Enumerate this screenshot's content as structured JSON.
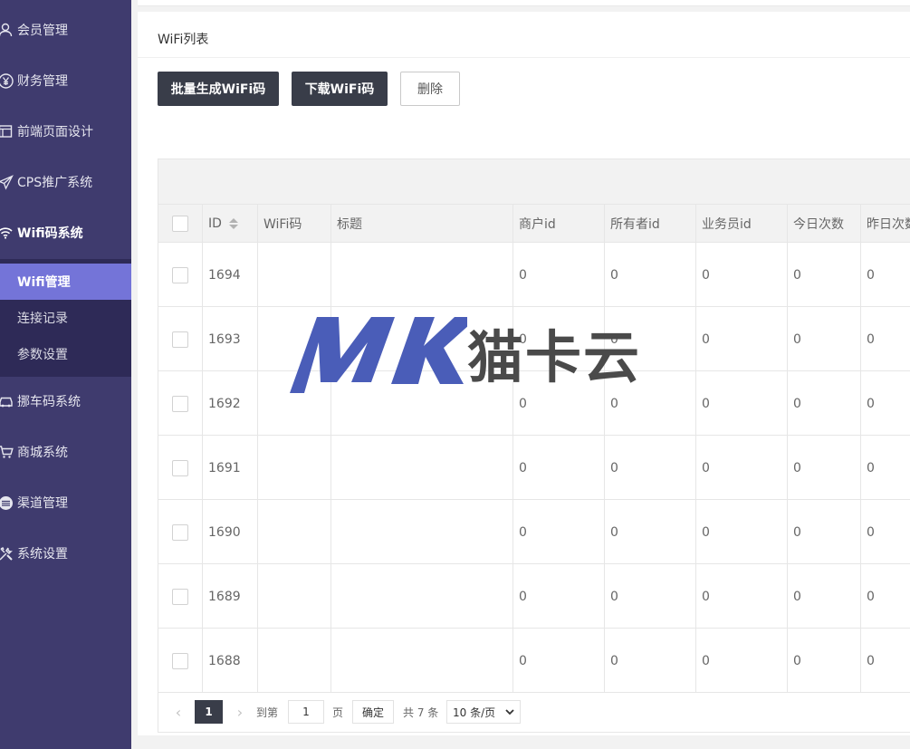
{
  "sidebar": {
    "items": [
      {
        "label": "会员管理",
        "icon": "user-icon"
      },
      {
        "label": "财务管理",
        "icon": "yen-icon"
      },
      {
        "label": "前端页面设计",
        "icon": "window-icon"
      },
      {
        "label": "CPS推广系统",
        "icon": "send-icon"
      },
      {
        "label": "Wifi码系统",
        "icon": "wifi-icon"
      },
      {
        "label": "挪车码系统",
        "icon": "car-icon"
      },
      {
        "label": "商城系统",
        "icon": "cart-icon"
      },
      {
        "label": "渠道管理",
        "icon": "channel-icon"
      },
      {
        "label": "系统设置",
        "icon": "tools-icon"
      }
    ],
    "submenu": [
      {
        "label": "Wifi管理"
      },
      {
        "label": "连接记录"
      },
      {
        "label": "参数设置"
      }
    ]
  },
  "card": {
    "title": "WiFi列表",
    "buttons": {
      "batch": "批量生成WiFi码",
      "download": "下载WiFi码",
      "delete": "删除"
    }
  },
  "table": {
    "columns": [
      "ID",
      "WiFi码",
      "标题",
      "商户id",
      "所有者id",
      "业务员id",
      "今日次数",
      "昨日次数"
    ],
    "rows": [
      [
        "1694",
        "",
        "",
        "0",
        "0",
        "0",
        "0",
        "0"
      ],
      [
        "1693",
        "",
        "",
        "0",
        "0",
        "0",
        "0",
        "0"
      ],
      [
        "1692",
        "",
        "",
        "0",
        "0",
        "0",
        "0",
        "0"
      ],
      [
        "1691",
        "",
        "",
        "0",
        "0",
        "0",
        "0",
        "0"
      ],
      [
        "1690",
        "",
        "",
        "0",
        "0",
        "0",
        "0",
        "0"
      ],
      [
        "1689",
        "",
        "",
        "0",
        "0",
        "0",
        "0",
        "0"
      ],
      [
        "1688",
        "",
        "",
        "0",
        "0",
        "0",
        "0",
        "0"
      ]
    ]
  },
  "pagination": {
    "prev": "‹",
    "current": "1",
    "next": "›",
    "goto_label": "到第",
    "goto_value": "1",
    "page_unit": "页",
    "confirm": "确定",
    "total": "共 7 条",
    "page_size": "10 条/页"
  },
  "watermark": {
    "logo_text": "MK",
    "text": "猫卡云"
  },
  "colors": {
    "sidebar_bg": "#3f3b6e",
    "submenu_bg": "#2e2a57",
    "active_item": "#7474d8",
    "dark_button": "#393d49",
    "watermark_logo": "#4a5db8"
  }
}
